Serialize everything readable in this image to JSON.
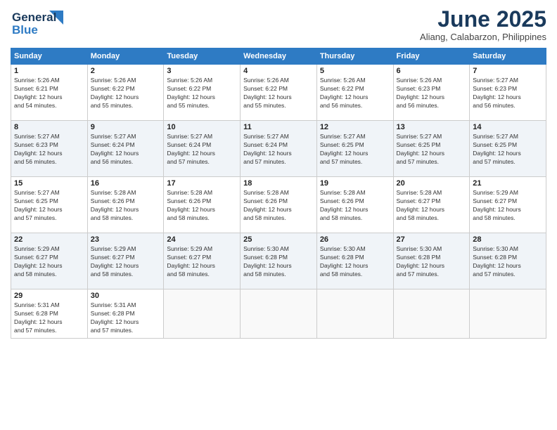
{
  "logo": {
    "line1": "General",
    "line2": "Blue"
  },
  "title": "June 2025",
  "location": "Aliang, Calabarzon, Philippines",
  "days_of_week": [
    "Sunday",
    "Monday",
    "Tuesday",
    "Wednesday",
    "Thursday",
    "Friday",
    "Saturday"
  ],
  "weeks": [
    [
      {
        "day": "1",
        "info": "Sunrise: 5:26 AM\nSunset: 6:21 PM\nDaylight: 12 hours\nand 54 minutes."
      },
      {
        "day": "2",
        "info": "Sunrise: 5:26 AM\nSunset: 6:22 PM\nDaylight: 12 hours\nand 55 minutes."
      },
      {
        "day": "3",
        "info": "Sunrise: 5:26 AM\nSunset: 6:22 PM\nDaylight: 12 hours\nand 55 minutes."
      },
      {
        "day": "4",
        "info": "Sunrise: 5:26 AM\nSunset: 6:22 PM\nDaylight: 12 hours\nand 55 minutes."
      },
      {
        "day": "5",
        "info": "Sunrise: 5:26 AM\nSunset: 6:22 PM\nDaylight: 12 hours\nand 56 minutes."
      },
      {
        "day": "6",
        "info": "Sunrise: 5:26 AM\nSunset: 6:23 PM\nDaylight: 12 hours\nand 56 minutes."
      },
      {
        "day": "7",
        "info": "Sunrise: 5:27 AM\nSunset: 6:23 PM\nDaylight: 12 hours\nand 56 minutes."
      }
    ],
    [
      {
        "day": "8",
        "info": "Sunrise: 5:27 AM\nSunset: 6:23 PM\nDaylight: 12 hours\nand 56 minutes."
      },
      {
        "day": "9",
        "info": "Sunrise: 5:27 AM\nSunset: 6:24 PM\nDaylight: 12 hours\nand 56 minutes."
      },
      {
        "day": "10",
        "info": "Sunrise: 5:27 AM\nSunset: 6:24 PM\nDaylight: 12 hours\nand 57 minutes."
      },
      {
        "day": "11",
        "info": "Sunrise: 5:27 AM\nSunset: 6:24 PM\nDaylight: 12 hours\nand 57 minutes."
      },
      {
        "day": "12",
        "info": "Sunrise: 5:27 AM\nSunset: 6:25 PM\nDaylight: 12 hours\nand 57 minutes."
      },
      {
        "day": "13",
        "info": "Sunrise: 5:27 AM\nSunset: 6:25 PM\nDaylight: 12 hours\nand 57 minutes."
      },
      {
        "day": "14",
        "info": "Sunrise: 5:27 AM\nSunset: 6:25 PM\nDaylight: 12 hours\nand 57 minutes."
      }
    ],
    [
      {
        "day": "15",
        "info": "Sunrise: 5:27 AM\nSunset: 6:25 PM\nDaylight: 12 hours\nand 57 minutes."
      },
      {
        "day": "16",
        "info": "Sunrise: 5:28 AM\nSunset: 6:26 PM\nDaylight: 12 hours\nand 58 minutes."
      },
      {
        "day": "17",
        "info": "Sunrise: 5:28 AM\nSunset: 6:26 PM\nDaylight: 12 hours\nand 58 minutes."
      },
      {
        "day": "18",
        "info": "Sunrise: 5:28 AM\nSunset: 6:26 PM\nDaylight: 12 hours\nand 58 minutes."
      },
      {
        "day": "19",
        "info": "Sunrise: 5:28 AM\nSunset: 6:26 PM\nDaylight: 12 hours\nand 58 minutes."
      },
      {
        "day": "20",
        "info": "Sunrise: 5:28 AM\nSunset: 6:27 PM\nDaylight: 12 hours\nand 58 minutes."
      },
      {
        "day": "21",
        "info": "Sunrise: 5:29 AM\nSunset: 6:27 PM\nDaylight: 12 hours\nand 58 minutes."
      }
    ],
    [
      {
        "day": "22",
        "info": "Sunrise: 5:29 AM\nSunset: 6:27 PM\nDaylight: 12 hours\nand 58 minutes."
      },
      {
        "day": "23",
        "info": "Sunrise: 5:29 AM\nSunset: 6:27 PM\nDaylight: 12 hours\nand 58 minutes."
      },
      {
        "day": "24",
        "info": "Sunrise: 5:29 AM\nSunset: 6:27 PM\nDaylight: 12 hours\nand 58 minutes."
      },
      {
        "day": "25",
        "info": "Sunrise: 5:30 AM\nSunset: 6:28 PM\nDaylight: 12 hours\nand 58 minutes."
      },
      {
        "day": "26",
        "info": "Sunrise: 5:30 AM\nSunset: 6:28 PM\nDaylight: 12 hours\nand 58 minutes."
      },
      {
        "day": "27",
        "info": "Sunrise: 5:30 AM\nSunset: 6:28 PM\nDaylight: 12 hours\nand 57 minutes."
      },
      {
        "day": "28",
        "info": "Sunrise: 5:30 AM\nSunset: 6:28 PM\nDaylight: 12 hours\nand 57 minutes."
      }
    ],
    [
      {
        "day": "29",
        "info": "Sunrise: 5:31 AM\nSunset: 6:28 PM\nDaylight: 12 hours\nand 57 minutes."
      },
      {
        "day": "30",
        "info": "Sunrise: 5:31 AM\nSunset: 6:28 PM\nDaylight: 12 hours\nand 57 minutes."
      },
      {
        "day": "",
        "info": ""
      },
      {
        "day": "",
        "info": ""
      },
      {
        "day": "",
        "info": ""
      },
      {
        "day": "",
        "info": ""
      },
      {
        "day": "",
        "info": ""
      }
    ]
  ]
}
